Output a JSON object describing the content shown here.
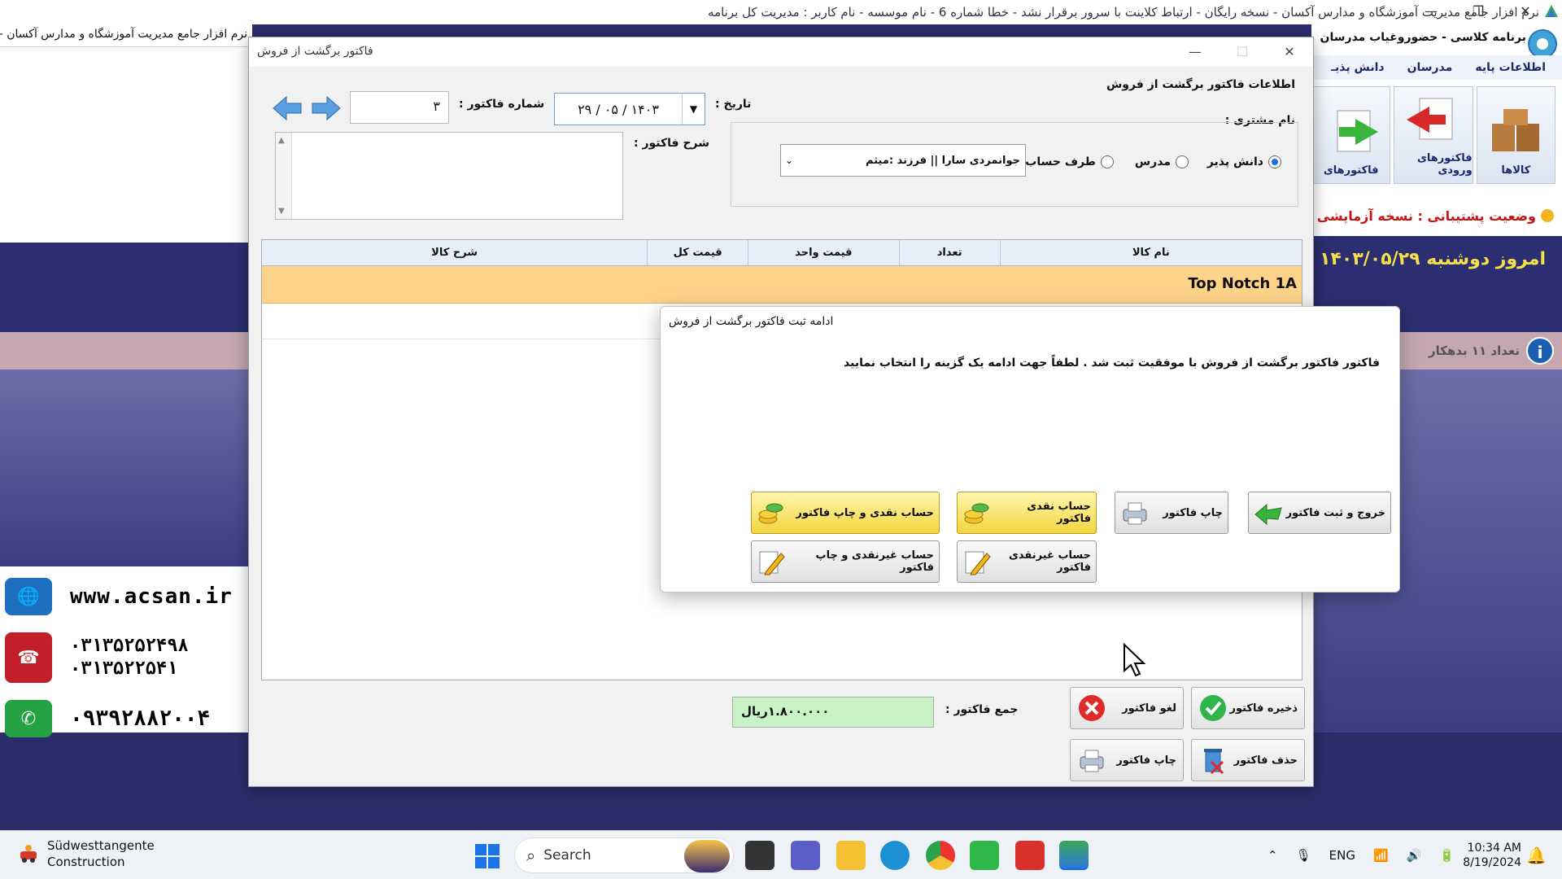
{
  "app": {
    "title": "نرم افزار جامع مدیریت آموزشگاه و مدارس آکسان - نسخه رایگان - ارتباط کلاینت با سرور برقرار نشد - خطا شماره 6 - نام موسسه - نام کاربر : مدیریت کل برنامه",
    "mdi_tab": "نرم افزار جامع مدیریت آموزشگاه و مدارس آکسان - نسخه رایگان - ارتباط ک...",
    "window_controls": [
      "—",
      "❐",
      "✕"
    ]
  },
  "right_panel": {
    "title": "برنامه کلاسی - حضوروغیاب مدرسان",
    "menu": [
      "اطلاعات پایه",
      "مدرسان",
      "دانش پذیـ"
    ],
    "tools": [
      "کالاها",
      "فاکتورهای ورودی",
      "فاکتورهای"
    ],
    "support": "وضعیت پشتیبانی : نسخه آزمایشی",
    "today": "امروز دوشنبه ۱۴۰۳/۰۵/۲۹",
    "debtors": "تعداد ۱۱ بدهکار"
  },
  "contacts": {
    "website": "www.acsan.ir",
    "phone1": "۰۳۱۳۵۲۵۲۴۹۸",
    "phone2": "۰۳۱۳۵۲۲۵۴۱",
    "whatsapp": "۰۹۳۹۲۸۸۲۰۰۴"
  },
  "dialog": {
    "title": "فاکتور برگشت از فروش",
    "controls": [
      "—",
      "☐",
      "✕"
    ],
    "section_title": "اطلاعات فاکتور برگشت از فروش",
    "invoice_no_label": "شماره فاکتور :",
    "invoice_no": "۳",
    "date_label": "تاریخ :",
    "date": "۱۴۰۳ / ۰۵ / ۲۹",
    "desc_label": "شرح فاکتور :",
    "customer_label": "نام مشتری :",
    "radios": [
      {
        "label": "دانش پذیر",
        "checked": true
      },
      {
        "label": "مدرس",
        "checked": false
      },
      {
        "label": "طرف حساب",
        "checked": false
      }
    ],
    "customer_value": "جوانمردی سارا || فرزند :میثم",
    "grid_headers": [
      "نام کالا",
      "تعداد",
      "قیمت واحد",
      "قیمت کل",
      "شرح کالا"
    ],
    "grid_row_name": "Top Notch 1A",
    "total_label": "جمع فاکتور :",
    "total_value": "۱.۸۰۰.۰۰۰ریال",
    "buttons": {
      "save": "ذخیره فاکتور",
      "cancel": "لغو فاکتور",
      "delete": "حذف فاکتور",
      "print": "چاپ فاکتور"
    }
  },
  "modal": {
    "title": "ادامه ثبت فاکتور برگشت از فروش",
    "message": "فاکتور فاکتور برگشت از فروش با موفقیت ثبت شد . لطفاً جهت ادامه یک گزینه را انتخاب نمایید",
    "buttons": {
      "exit_save": "خروج و ثبت فاکتور",
      "print": "چاپ فاکتور",
      "cash": "حساب نقدی فاکتور",
      "cash_print": "حساب نقدی و چاپ فاکتور",
      "noncash": "حساب غیرنقدی فاکتور",
      "noncash_print": "حساب غیرنقدی و چاپ فاکتور"
    }
  },
  "taskbar": {
    "weather_title": "Südwesttangente",
    "weather_sub": "Construction",
    "search": "Search",
    "lang": "ENG",
    "time": "10:34 AM",
    "date": "8/19/2024"
  },
  "colors": {
    "accent": "#1a6ee0",
    "row_highlight": "#fdd38a",
    "total_bg": "#c7f3c7",
    "bg_band": "#2b2e70"
  }
}
